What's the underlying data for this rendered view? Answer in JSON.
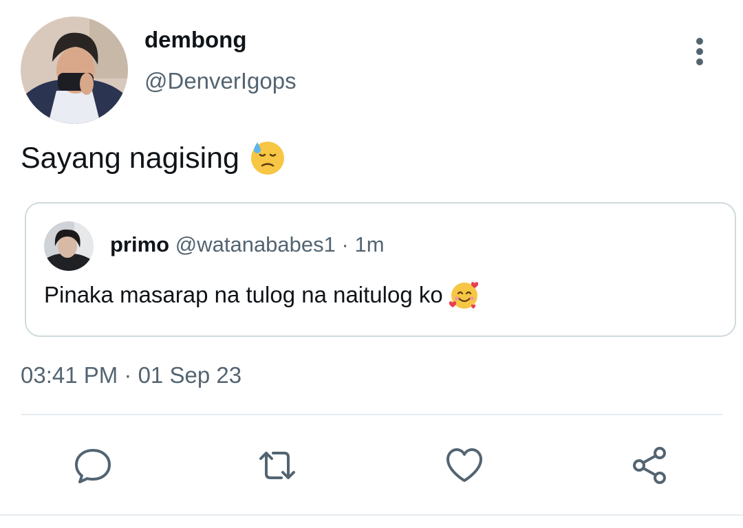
{
  "tweet": {
    "author": {
      "display_name": "dembong",
      "handle": "@DenverIgops",
      "avatar_icon": "user-photo"
    },
    "text": "Sayang nagising",
    "emoji": "downcast-face-with-sweat",
    "timestamp": "03:41 PM · 01 Sep 23"
  },
  "quoted_tweet": {
    "display_name": "primo",
    "handle": "@watanababes1",
    "separator": "·",
    "time_ago": "1m",
    "text": "Pinaka masarap na tulog na naitulog ko",
    "emoji": "smiling-face-with-hearts",
    "avatar_icon": "user-photo"
  },
  "actions": [
    {
      "name": "reply",
      "icon": "chat-bubble-icon"
    },
    {
      "name": "retweet",
      "icon": "retweet-icon"
    },
    {
      "name": "like",
      "icon": "heart-icon"
    },
    {
      "name": "share",
      "icon": "share-icon"
    }
  ],
  "colors": {
    "text_primary": "#0f1419",
    "text_secondary": "#536471",
    "border": "#cfd9de",
    "icon": "#536471"
  }
}
